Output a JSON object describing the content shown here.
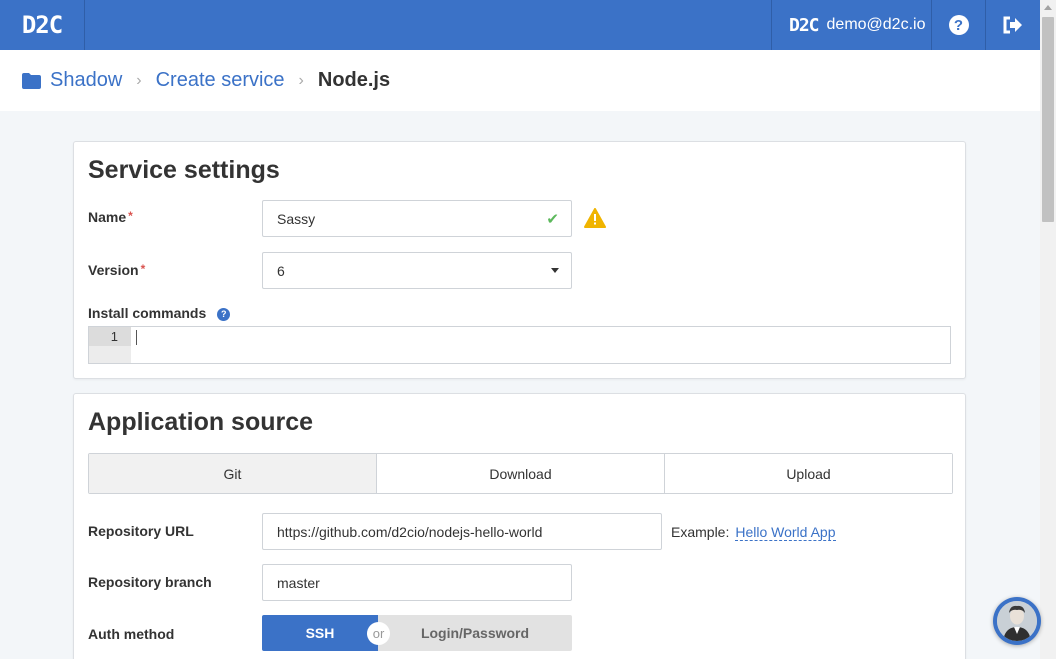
{
  "header": {
    "logo": "D2C",
    "user_badge": "D2C",
    "user_email": "demo@d2c.io",
    "help_icon": "question-circle-icon",
    "logout_icon": "sign-out-icon"
  },
  "breadcrumb": {
    "items": [
      "Shadow",
      "Create service"
    ],
    "current": "Node.js",
    "folder_icon": "folder-icon"
  },
  "service_settings": {
    "title": "Service settings",
    "name_label": "Name",
    "name_value": "Sassy",
    "version_label": "Version",
    "version_value": "6",
    "install_label": "Install commands",
    "install_line_number": "1",
    "required_mark": "*"
  },
  "application_source": {
    "title": "Application source",
    "tabs": [
      "Git",
      "Download",
      "Upload"
    ],
    "active_tab": "Git",
    "repo_url_label": "Repository URL",
    "repo_url_value": "https://github.com/d2cio/nodejs-hello-world",
    "example_label": "Example:",
    "example_link": "Hello World App",
    "branch_label": "Repository branch",
    "branch_value": "master",
    "auth_label": "Auth method",
    "auth_ssh": "SSH",
    "auth_or": "or",
    "auth_login": "Login/Password"
  },
  "colors": {
    "brand": "#3b72c7",
    "warning": "#f0b400",
    "success": "#5cb85c"
  }
}
